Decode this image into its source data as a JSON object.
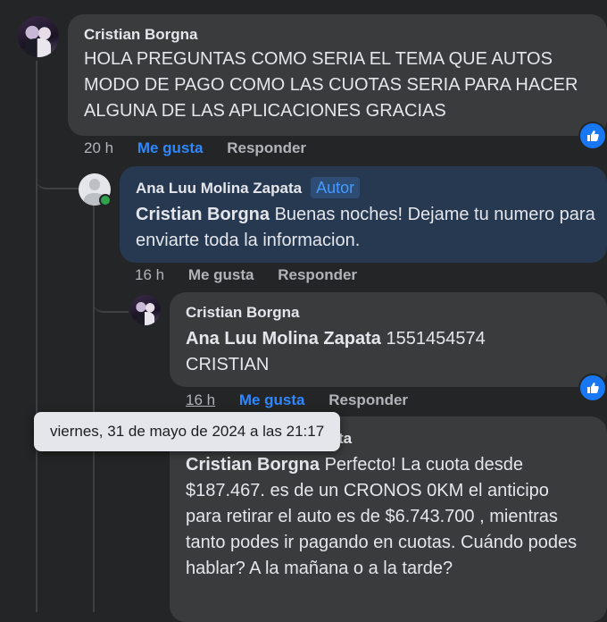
{
  "comments": [
    {
      "author": "Cristian Borgna",
      "text": "HOLA PREGUNTAS COMO SERIA EL TEMA QUE AUTOS MODO DE PAGO COMO LAS CUOTAS SERIA PARA HACER ALGUNA DE LAS APLICACIONES GRACIAS",
      "time": "20 h",
      "like_label": "Me gusta",
      "reply_label": "Responder"
    },
    {
      "author": "Ana Luu Molina Zapata",
      "badge": "Autor",
      "mention": "Cristian Borgna",
      "text": " Buenas noches! Dejame tu numero para enviarte toda la informacion.",
      "time": "16 h",
      "like_label": "Me gusta",
      "reply_label": "Responder"
    },
    {
      "author": "Cristian Borgna",
      "mention": "Ana Luu Molina Zapata",
      "text": " 1551454574 CRISTIAN",
      "time": "16 h",
      "like_label": "Me gusta",
      "reply_label": "Responder"
    },
    {
      "author": "Ana Luu Molina Zapata",
      "mention": "Cristian Borgna",
      "text": " Perfecto! La cuota desde $187.467. es de un CRONOS 0KM el anticipo para retirar el auto es de $6.743.700 , mientras tanto podes ir pagando en cuotas. Cuándo podes hablar? A la mañana o a la tarde?"
    }
  ],
  "tooltip": "viernes, 31 de mayo de 2024 a las 21:17",
  "colors": {
    "accent": "#2d88ff",
    "author_bubble": "#263951",
    "bubble": "#3a3b3c"
  }
}
